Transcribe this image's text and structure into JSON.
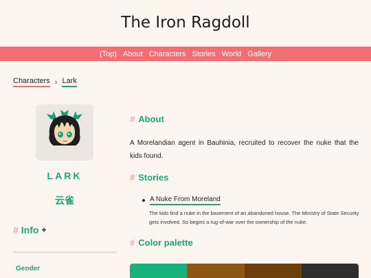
{
  "site": {
    "title": "The Iron Ragdoll"
  },
  "nav": [
    {
      "label": "(Top)"
    },
    {
      "label": "About"
    },
    {
      "label": "Characters"
    },
    {
      "label": "Stories"
    },
    {
      "label": "World"
    },
    {
      "label": "Gallery"
    }
  ],
  "breadcrumb": {
    "parent": "Characters",
    "current": "Lark"
  },
  "character": {
    "name": "LARK",
    "name_cn": "云雀",
    "avatar_icon": "character-portrait-icon"
  },
  "info": {
    "heading": "Info",
    "toggle": "+",
    "fields": [
      {
        "label": "Gender"
      }
    ]
  },
  "about": {
    "heading": "About",
    "text": "A Morelandian agent in Bauhinia, recruited to recover the nuke that the kids found."
  },
  "stories": {
    "heading": "Stories",
    "items": [
      {
        "title": "A Nuke From Moreland",
        "description": "The kids find a nuke in the basement of an abandoned house. The Ministry of State Security gets involved. So begins a tug-of-war over the ownership of the nuke."
      }
    ]
  },
  "palette": {
    "heading": "Color palette",
    "colors": [
      "#16b37c",
      "#8c5613",
      "#6d3f0a",
      "#2e2e2e"
    ]
  },
  "theme": {
    "accent": "#1aa67a",
    "nav_bg": "#ef6f74",
    "hash": "#f3a3a6"
  }
}
